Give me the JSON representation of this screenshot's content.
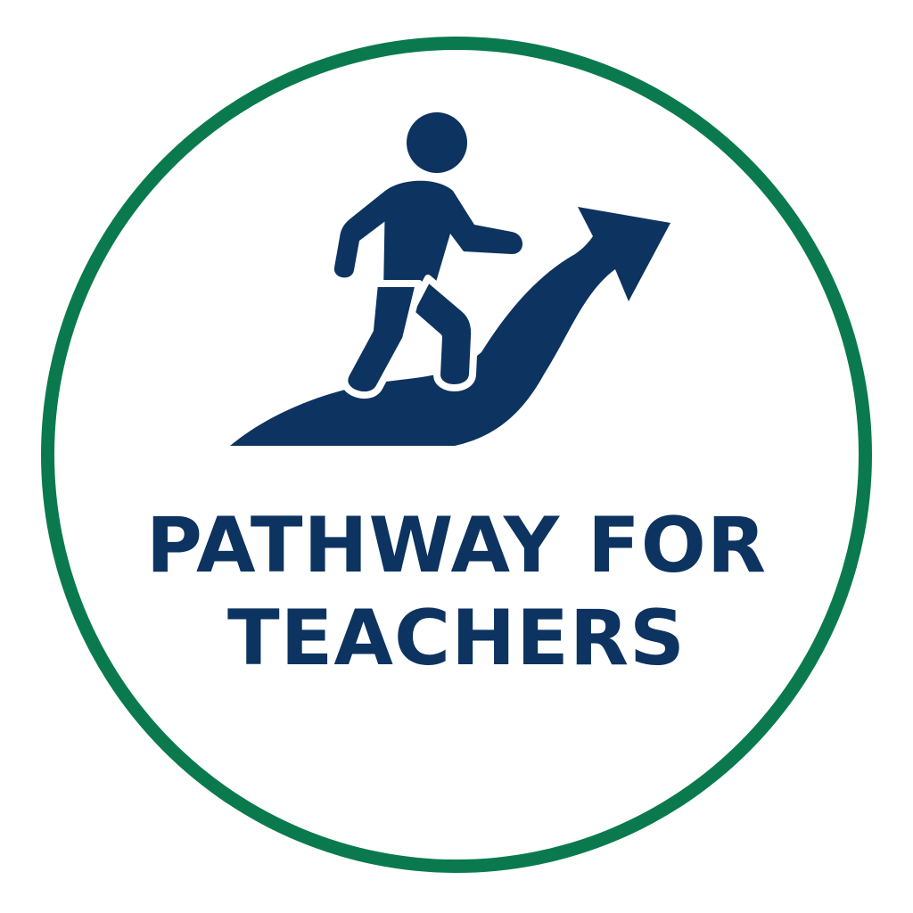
{
  "badge": {
    "title_line1": "PATHWAY FOR",
    "title_line2": "TEACHERS",
    "icon": "person-climbing-upward-path-icon",
    "colors": {
      "ring": "#0a7a4e",
      "primary": "#0d3360",
      "background": "#ffffff"
    }
  }
}
